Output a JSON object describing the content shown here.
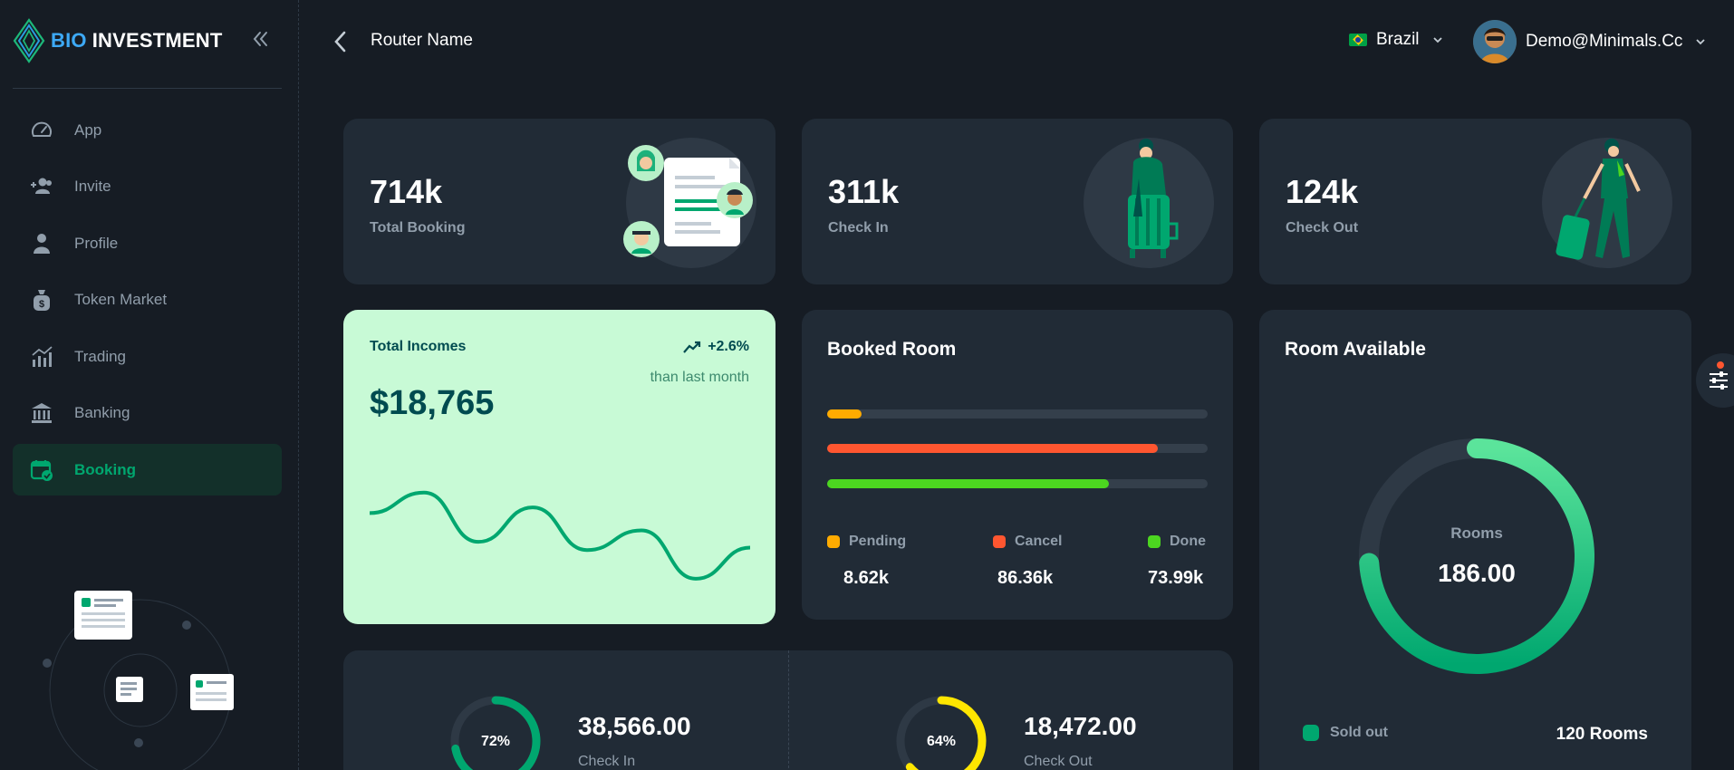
{
  "brand": {
    "word1": "BIO",
    "word2": "INVESTMENT"
  },
  "sidebar": {
    "items": [
      {
        "label": "App",
        "icon": "dashboard-icon",
        "active": false
      },
      {
        "label": "Invite",
        "icon": "invite-users-icon",
        "active": false
      },
      {
        "label": "Profile",
        "icon": "user-icon",
        "active": false
      },
      {
        "label": "Token Market",
        "icon": "token-bag-icon",
        "active": false
      },
      {
        "label": "Trading",
        "icon": "trading-chart-icon",
        "active": false
      },
      {
        "label": "Banking",
        "icon": "bank-icon",
        "active": false
      },
      {
        "label": "Booking",
        "icon": "calendar-check-icon",
        "active": true
      }
    ]
  },
  "header": {
    "router_name": "Router Name",
    "language": "Brazil",
    "user_email": "Demo@Minimals.Cc"
  },
  "stats": [
    {
      "value": "714k",
      "label": "Total Booking"
    },
    {
      "value": "311k",
      "label": "Check In"
    },
    {
      "value": "124k",
      "label": "Check Out"
    }
  ],
  "income": {
    "title": "Total Incomes",
    "change": "+2.6%",
    "compare": "than last month",
    "amount": "$18,765",
    "trend": [
      111,
      136,
      76,
      118,
      66,
      90,
      31,
      69
    ]
  },
  "booked_room": {
    "title": "Booked Room",
    "bars": [
      {
        "name": "Pending",
        "fraction": 0.09,
        "color": "#ffab00"
      },
      {
        "name": "Cancel",
        "fraction": 0.87,
        "color": "#ff5630"
      },
      {
        "name": "Done",
        "fraction": 0.74,
        "color": "#4cd620"
      }
    ],
    "legend": [
      {
        "name": "Pending",
        "value": "8.62k",
        "color": "#ffab00"
      },
      {
        "name": "Cancel",
        "value": "86.36k",
        "color": "#ff5630"
      },
      {
        "name": "Done",
        "value": "73.99k",
        "color": "#4cd620"
      }
    ]
  },
  "room_available": {
    "title": "Room Available",
    "center_label": "Rooms",
    "center_value": "186.00",
    "fraction": 0.74,
    "sold_out_label": "Sold out",
    "sold_out_value": "120 Rooms"
  },
  "check_summary": [
    {
      "percent": "72%",
      "fraction": 0.72,
      "value": "38,566.00",
      "label": "Check In",
      "color": "#00a76f"
    },
    {
      "percent": "64%",
      "fraction": 0.64,
      "value": "18,472.00",
      "label": "Check Out",
      "color": "#ffe600"
    }
  ],
  "colors": {
    "background": "#161c24",
    "card": "#212b36",
    "primary": "#00a76f",
    "income_bg": "#c8fad6"
  }
}
